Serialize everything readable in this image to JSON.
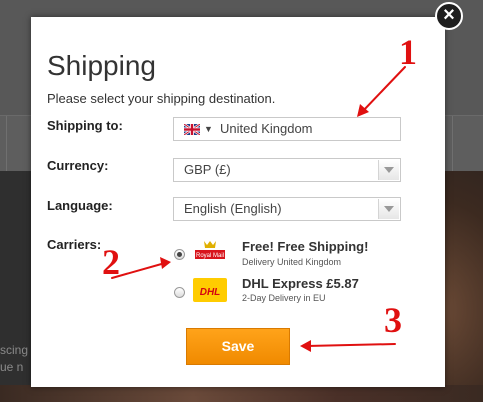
{
  "background": {
    "text_line_1": "scing",
    "text_line_2": "ue n"
  },
  "modal": {
    "close_label": "×",
    "title": "Shipping",
    "subtitle": "Please select your shipping destination.",
    "shipping_to": {
      "label": "Shipping to:",
      "value": "United Kingdom",
      "flag_icon": "uk-flag-icon"
    },
    "currency": {
      "label": "Currency:",
      "value": "GBP (£)"
    },
    "language": {
      "label": "Language:",
      "value": "English (English)"
    },
    "carriers": {
      "label": "Carriers:",
      "items": [
        {
          "name": "Free! Free Shipping!",
          "description": "Delivery United Kingdom",
          "logo_text": "Royal Mail",
          "selected": true
        },
        {
          "name": "DHL Express £5.87",
          "description": "2-Day Delivery in EU",
          "logo_text": "DHL",
          "selected": false
        }
      ]
    },
    "save_label": "Save"
  },
  "annotations": {
    "marker_1": "1",
    "marker_2": "2",
    "marker_3": "3",
    "color": "#e01010"
  },
  "colors": {
    "save_button": "#f59400",
    "overlay": "#4a4a4a"
  }
}
